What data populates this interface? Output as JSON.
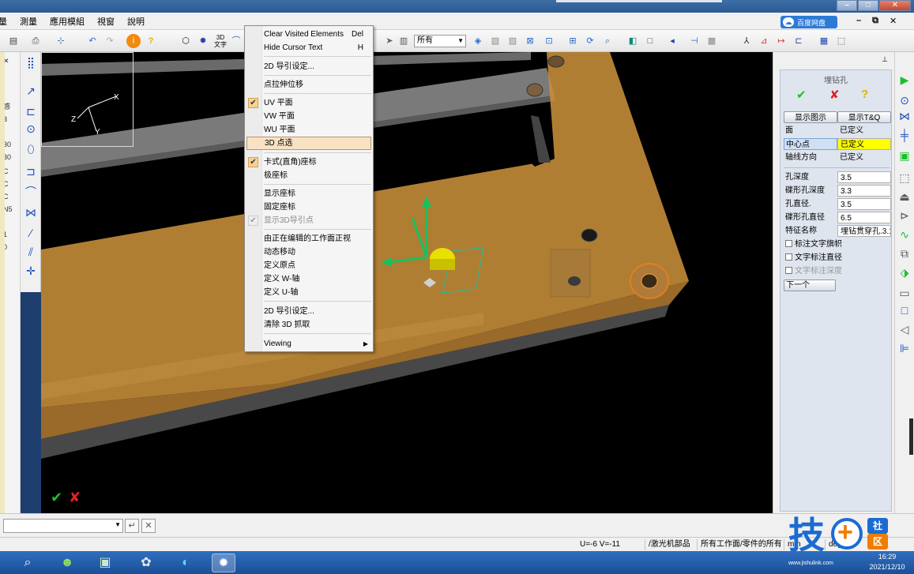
{
  "menu": {
    "items": [
      "量",
      "測量",
      "應用模組",
      "視窗",
      "說明"
    ]
  },
  "cloud_badge": "百度网盘",
  "toolbar": {
    "select_value": "所有",
    "text_3d": "3D",
    "text_3d_sub": "文字"
  },
  "left_strip_labels": [
    "感",
    "3",
    "30",
    "30",
    "C",
    "C",
    "C",
    "N5",
    "1",
    "0"
  ],
  "context_menu": {
    "items": [
      {
        "label": "Clear Visited Elements",
        "shortcut": "Del"
      },
      {
        "label": "Hide Cursor Text",
        "shortcut": "H"
      },
      {
        "label": "2D 导引设定..."
      },
      {
        "label": "点拉伸位移"
      },
      {
        "label": "UV 平面",
        "checked": true
      },
      {
        "label": "VW 平面"
      },
      {
        "label": "WU 平面"
      },
      {
        "label": "3D 点选",
        "highlighted": true
      },
      {
        "label": "卡式(直角)座标",
        "checked": true
      },
      {
        "label": "极座标"
      },
      {
        "label": "显示座标"
      },
      {
        "label": "固定座标"
      },
      {
        "label": "显示3D导引点",
        "checked": true,
        "disabled": true
      },
      {
        "label": "由正在编辑的工作面正视"
      },
      {
        "label": "动态移动"
      },
      {
        "label": "定义原点"
      },
      {
        "label": "定义 W-轴"
      },
      {
        "label": "定义 U-轴"
      },
      {
        "label": "2D 导引设定..."
      },
      {
        "label": "清除 3D 抓取"
      },
      {
        "label": "Viewing",
        "submenu": true
      }
    ]
  },
  "dialog": {
    "title": "埋钻孔",
    "show_graphic_label": "显示图示",
    "show_tq_label": "显示T&Q",
    "rows_top": [
      {
        "key": "面",
        "value": "已定义"
      },
      {
        "key": "中心点",
        "value": "已定义"
      },
      {
        "key": "轴线方向",
        "value": "已定义"
      }
    ],
    "rows_params": [
      {
        "key": "孔深度",
        "value": "3.5"
      },
      {
        "key": "碟形孔深度",
        "value": "3.3"
      },
      {
        "key": "孔直径.",
        "value": "3.5"
      },
      {
        "key": "碟形孔直径",
        "value": "6.5"
      },
      {
        "key": "特征名称",
        "value": "埋钻贯穿孔.3.1"
      }
    ],
    "checkboxes": [
      {
        "label": "标注文字旗帜"
      },
      {
        "label": "文字标注直径"
      },
      {
        "label": "文字标注深度",
        "disabled": true
      }
    ],
    "next_label": "下一个"
  },
  "status": {
    "uv": "U=-6 V=-11",
    "part": "/激光机部品",
    "scope": "所有工作面/零件的所有",
    "unit": "mm",
    "mode": "deg"
  },
  "taskbar": {
    "time": "16:29",
    "date": "2021/12/10"
  },
  "watermark": {
    "char1": "技",
    "plus": "+",
    "char2": "社",
    "char3": "区",
    "url": "www.jishulink.com"
  },
  "colors": {
    "part_fill": "#c8903a",
    "viewport_bg": "#000000",
    "highlight": "#ffff00",
    "accent": "#1b6bd1"
  }
}
